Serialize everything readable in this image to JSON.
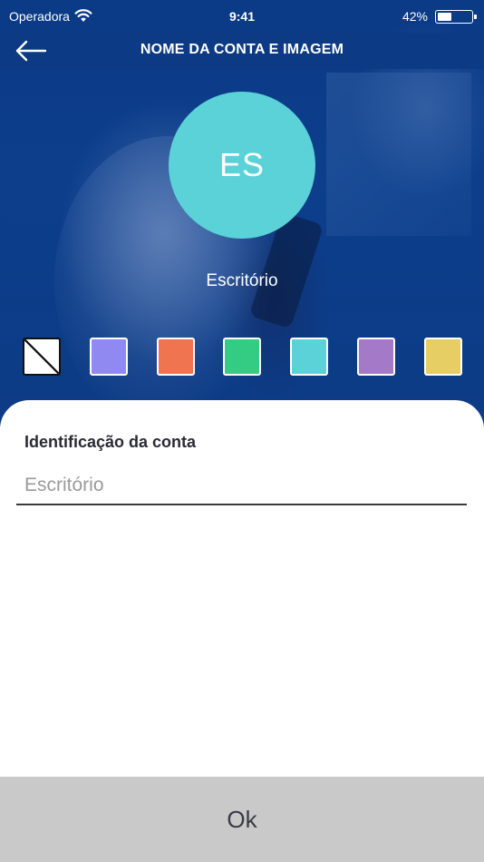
{
  "status_bar": {
    "carrier": "Operadora",
    "time": "9:41",
    "battery_percent": "42%",
    "battery_level": 0.42
  },
  "nav": {
    "title": "NOME DA CONTA E IMAGEM",
    "back_icon": "arrow-left-icon"
  },
  "avatar": {
    "initials": "ES",
    "color": "#5ad2d8"
  },
  "account_label": "Escritório",
  "swatches": [
    {
      "name": "none",
      "color": "#ffffff",
      "selected": true
    },
    {
      "name": "lavender",
      "color": "#9089f2"
    },
    {
      "name": "orange",
      "color": "#f07450"
    },
    {
      "name": "green",
      "color": "#33cc82"
    },
    {
      "name": "cyan",
      "color": "#5ad2d8"
    },
    {
      "name": "purple",
      "color": "#a47ac8"
    },
    {
      "name": "yellow",
      "color": "#e6ce64"
    }
  ],
  "form": {
    "label": "Identificação da conta",
    "value": "Escritório"
  },
  "ok_label": "Ok"
}
